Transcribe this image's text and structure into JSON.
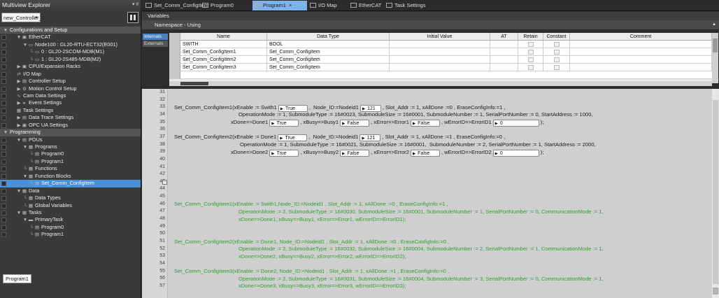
{
  "explorer": {
    "title": "Multiview Explorer",
    "pin": "▾ ♯",
    "controller": "new_Controller_0",
    "items": [
      {
        "label": "Configurations and Setup",
        "indent": 0,
        "arrow": "▼",
        "icon": "",
        "header": true
      },
      {
        "label": "EtherCAT",
        "indent": 1,
        "arrow": "▼",
        "icon": "▣"
      },
      {
        "label": "Node100 : GL20-RTU-ECT32(E001)",
        "indent": 2,
        "arrow": "▼",
        "icon": "▭"
      },
      {
        "label": "0 : GL20-2SCOM-MDB(M1)",
        "indent": 3,
        "arrow": "└",
        "icon": "▭"
      },
      {
        "label": "1 : GL20-2S485-MDB(M2)",
        "indent": 3,
        "arrow": "└",
        "icon": "▭"
      },
      {
        "label": "CPU/Expansion Racks",
        "indent": 1,
        "arrow": "▶",
        "icon": "▣"
      },
      {
        "label": "I/O Map",
        "indent": 1,
        "arrow": "",
        "icon": "⇄"
      },
      {
        "label": "Controller Setup",
        "indent": 1,
        "arrow": "▶",
        "icon": "▤"
      },
      {
        "label": "Motion Control Setup",
        "indent": 1,
        "arrow": "▶",
        "icon": "⚙"
      },
      {
        "label": "Cam Data Settings",
        "indent": 1,
        "arrow": "",
        "icon": "∿"
      },
      {
        "label": "Event Settings",
        "indent": 1,
        "arrow": "▶",
        "icon": "▸"
      },
      {
        "label": "Task Settings",
        "indent": 1,
        "arrow": "",
        "icon": "▦"
      },
      {
        "label": "Data Trace Settings",
        "indent": 1,
        "arrow": "▶",
        "icon": "▤"
      },
      {
        "label": "OPC UA Settings",
        "indent": 1,
        "arrow": "▶",
        "icon": "▣"
      },
      {
        "label": "Programming",
        "indent": 0,
        "arrow": "▼",
        "icon": "",
        "header": true
      },
      {
        "label": "POUs",
        "indent": 1,
        "arrow": "▼",
        "icon": "▤"
      },
      {
        "label": "Programs",
        "indent": 2,
        "arrow": "▼",
        "icon": "▦"
      },
      {
        "label": "Program0",
        "indent": 3,
        "arrow": "└",
        "icon": "▤"
      },
      {
        "label": "Program1",
        "indent": 3,
        "arrow": "└",
        "icon": "▤"
      },
      {
        "label": "Functions",
        "indent": 2,
        "arrow": "└",
        "icon": "▦"
      },
      {
        "label": "Function Blocks",
        "indent": 2,
        "arrow": "▼",
        "icon": "▦"
      },
      {
        "label": "Set_Comm_ConfigItem",
        "indent": 3,
        "arrow": "└",
        "icon": "▤",
        "selected": true
      },
      {
        "label": "Data",
        "indent": 1,
        "arrow": "▼",
        "icon": "▦"
      },
      {
        "label": "Data Types",
        "indent": 2,
        "arrow": "└",
        "icon": "▦"
      },
      {
        "label": "Global Variables",
        "indent": 2,
        "arrow": "└",
        "icon": "▦"
      },
      {
        "label": "Tasks",
        "indent": 1,
        "arrow": "▼",
        "icon": "▦"
      },
      {
        "label": "PrimaryTask",
        "indent": 2,
        "arrow": "▼",
        "icon": "▬"
      },
      {
        "label": "Program0",
        "indent": 3,
        "arrow": "└",
        "icon": "▤"
      },
      {
        "label": "Program1",
        "indent": 3,
        "arrow": "└",
        "icon": "▤"
      }
    ],
    "bottom_tab": "Program1"
  },
  "tabs": [
    {
      "label": "Set_Comm_ConfigItem",
      "active": false
    },
    {
      "label": "Program0",
      "active": false
    },
    {
      "label": "Program1",
      "active": true
    },
    {
      "label": "I/O Map",
      "active": false
    },
    {
      "label": "EtherCAT",
      "active": false
    },
    {
      "label": "Task Settings",
      "active": false
    }
  ],
  "variables": {
    "title": "Variables",
    "namespace": "Namespace - Using",
    "side_tabs": [
      "Internals",
      "Externals"
    ],
    "columns": [
      "Name",
      "Data Type",
      "Initial Value",
      "AT",
      "Retain",
      "Constant",
      "Comment"
    ],
    "rows": [
      {
        "name": "SWITH",
        "type": "BOOL"
      },
      {
        "name": "Set_Comm_ConfigItem1",
        "type": "Set_Comm_ConfigItem"
      },
      {
        "name": "Set_Comm_ConfigItem2",
        "type": "Set_Comm_ConfigItem"
      },
      {
        "name": "Set_Comm_ConfigItem3",
        "type": "Set_Comm_ConfigItem"
      }
    ]
  },
  "editor": {
    "line_numbers": [
      "31",
      "32",
      "33",
      "34",
      "35",
      "36",
      "37",
      "38",
      "39",
      "40",
      "41",
      "42",
      "43",
      "44",
      "45",
      "46",
      "47",
      "48",
      "49",
      "50",
      "51",
      "52",
      "53",
      "54",
      "55",
      "56",
      "57"
    ],
    "lines": [
      {
        "parts": [
          "Set_Comm_ConfigItem1(xEnable := Swith1",
          {
            "pill": "True",
            "w": 42
          },
          ",  Node_ID:=Nodeid1",
          {
            "pill": "121",
            "w": 30
          },
          ", Slot_Addr := 1, xAllDone :=0 , EraseConfigInfo:=1 ,"
        ]
      },
      {
        "parts": [
          "OperationMode := 1, SubmoduleType := 16#0023, SubmoduleSize := 16#0001, SubmoduleNumber := 1, SerialPortNumber := 0, StartAddress := 1000,"
        ]
      },
      {
        "parts": [
          "xDone=>Done1",
          {
            "pill": "True",
            "w": 42
          },
          ", xBusy=>Busy1",
          {
            "pill": "False",
            "w": 42
          },
          ", xError=>Error1",
          {
            "pill": "False",
            "w": 42
          },
          ", wErrorID=>ErrorID1",
          {
            "pill": "0",
            "w": 66
          },
          ");"
        ]
      },
      {
        "parts": [
          "Set_Comm_ConfigItem2(xEnable := Done1",
          {
            "pill": "True",
            "w": 42
          },
          ",  Node_ID:=Nodeid1",
          {
            "pill": "121",
            "w": 30
          },
          ", Slot_Addr := 1, xAllDone :=1 , EraseConfigInfo:=0 ,"
        ]
      },
      {
        "parts": [
          "OperationMode := 1, SubmoduleType := 16#0021, SubmoduleSize := 16#0001,  SubmoduleNumber := 2, SerialPortNumber := 1, StartAddress := 2000,"
        ]
      },
      {
        "parts": [
          "xDone=>Done2",
          {
            "pill": "True",
            "w": 42
          },
          ", xBusy=>Busy2",
          {
            "pill": "False",
            "w": 42
          },
          ", xError=>Error2",
          {
            "pill": "False",
            "w": 42
          },
          ", wErrorID=>ErrorID2",
          {
            "pill": "0",
            "w": 66
          },
          ");"
        ]
      },
      {
        "parts": [
          "Set_Comm_ConfigItem1(xEnable := Swith1,Node_ID:=Nodeid1 , Slot_Addr := 1, xAllDone :=0 , EraseConfigInfo:=1 ,"
        ]
      },
      {
        "parts": [
          "OperationMode := 2, SubmoduleType := 16#0030, SubmoduleSize := 16#0001, SubmoduleNumber := 1, SerialPortNumber := 0, CommunicationMode := 1,"
        ]
      },
      {
        "parts": [
          "xDone=>Done1, xBusy=>Busy1, xError=>Error1, wErrorID=>ErrorID1);"
        ]
      },
      {
        "parts": [
          "Set_Comm_ConfigItem2(xEnable := Done1, Node_ID:=Nodeid1 , Slot_Addr := 1, xAllDone :=0 , EraseConfigInfo:=0 ,"
        ]
      },
      {
        "parts": [
          "OperationMode := 2, SubmoduleType := 16#0032, SubmoduleSize := 16#0004, SubmoduleNumber := 2, SerialPortNumber := 1, CommunicationMode := 1,"
        ]
      },
      {
        "parts": [
          "xDone=>Done2, xBusy=>Busy2, xError=>Error2, wErrorID=>ErrorID2);"
        ]
      },
      {
        "parts": [
          "Set_Comm_ConfigItem3(xEnable := Done2, Node_ID:=Nodeid1 , Slot_Addr := 1, xAllDone :=1 , EraseConfigInfo:=0 ,"
        ]
      },
      {
        "parts": [
          "OperationMode := 2, SubmoduleType := 16#0031, SubmoduleSize := 16#0004, SubmoduleNumber := 3, SerialPortNumber := 0, CommunicationMode := 1,"
        ]
      },
      {
        "parts": [
          "xDone=>Done3, xBusy=>Busy3, xError=>Error3, wErrorID=>ErrorID3);"
        ]
      }
    ]
  },
  "colors": {
    "active_tab": "#7db3e8",
    "selection": "#4a90d9",
    "comment_green": "#2fa12f"
  }
}
